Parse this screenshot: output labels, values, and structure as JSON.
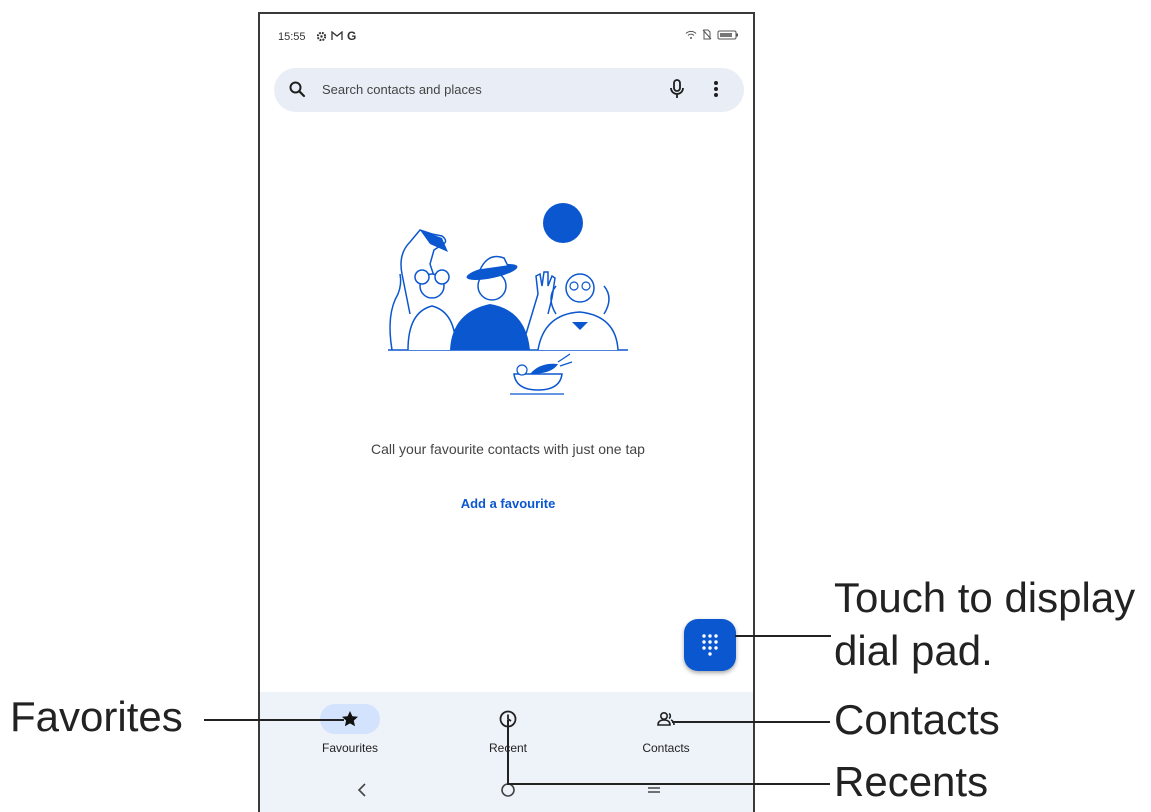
{
  "status_bar": {
    "time": "15:55",
    "left_icons": [
      "settings-icon",
      "gmail-icon",
      "google-icon"
    ],
    "right_icons": [
      "wifi-icon",
      "no-sim-icon",
      "battery-icon"
    ],
    "google_glyph": "G"
  },
  "search": {
    "placeholder": "Search contacts and places",
    "icons": [
      "search-icon",
      "mic-icon",
      "more-vert-icon"
    ]
  },
  "empty_state": {
    "message": "Call your favourite contacts with just one tap",
    "action": "Add a favourite"
  },
  "fab": {
    "icon": "dialpad-icon"
  },
  "bottom_nav": {
    "items": [
      {
        "label": "Favourites",
        "icon": "star-icon",
        "active": true
      },
      {
        "label": "Recent",
        "icon": "clock-icon",
        "active": false
      },
      {
        "label": "Contacts",
        "icon": "contacts-icon",
        "active": false
      }
    ]
  },
  "system_nav": [
    "back-icon",
    "home-icon",
    "recents-icon"
  ],
  "callouts": {
    "dial_pad_line1": "Touch to display",
    "dial_pad_line2": "dial pad.",
    "favorites": "Favorites",
    "contacts": "Contacts",
    "recents": "Recents"
  },
  "colors": {
    "accent": "#0b57d0",
    "search_bg": "#e9eef6",
    "nav_bg": "#eef2f9",
    "active_pill": "#d3e3fd"
  }
}
